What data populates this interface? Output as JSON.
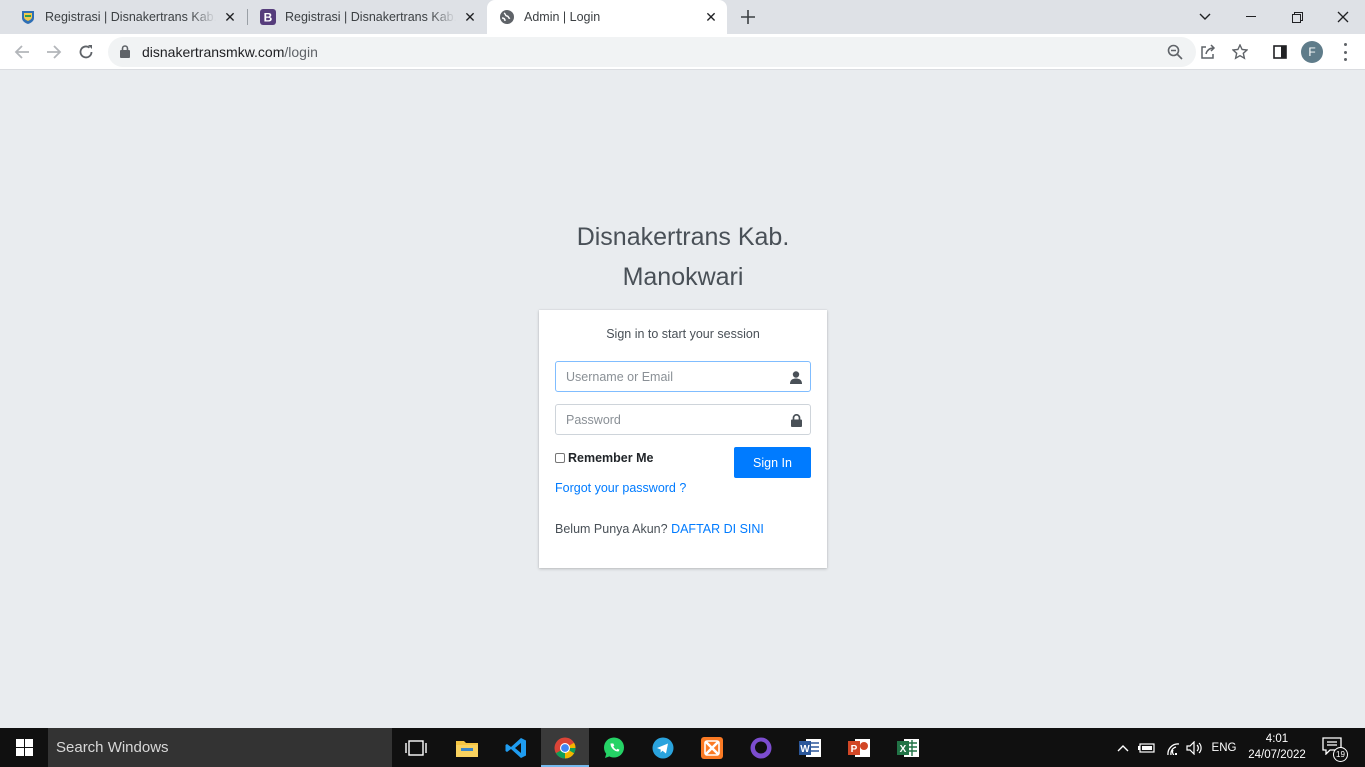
{
  "browser": {
    "tabs": [
      {
        "title": "Registrasi | Disnakertrans Kab. Manokwari",
        "favicon": "manokwari-emblem-icon"
      },
      {
        "title": "Registrasi | Disnakertrans Kab. Manokwari",
        "favicon": "bootstrap-icon"
      },
      {
        "title": "Admin | Login",
        "favicon": "globe-icon"
      }
    ],
    "url_domain": "disnakertransmkw.com",
    "url_path": "/login",
    "profile_initial": "F"
  },
  "login": {
    "brand_line1": "Disnakertrans Kab.",
    "brand_line2": "Manokwari",
    "message": "Sign in to start your session",
    "username_placeholder": "Username or Email",
    "password_placeholder": "Password",
    "remember_label": "Remember Me",
    "signin_label": "Sign In",
    "forgot_label": "Forgot your password ?",
    "register_text": "Belum Punya Akun?",
    "register_link": "DAFTAR DI SINI"
  },
  "taskbar": {
    "search_placeholder": "Search Windows",
    "apps": [
      "task-view",
      "file-explorer",
      "vscode",
      "chrome",
      "whatsapp",
      "telegram",
      "xampp",
      "github-desktop",
      "word",
      "powerpoint",
      "excel"
    ],
    "language": "ENG",
    "time": "4:01",
    "date": "24/07/2022",
    "notification_count": "19"
  },
  "colors": {
    "primary": "#007bff",
    "page_bg": "#e9ecef",
    "taskbar_bg": "#101010"
  }
}
